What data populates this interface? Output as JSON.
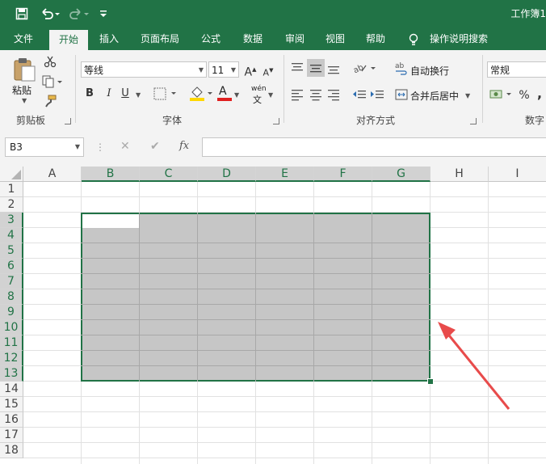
{
  "app": {
    "title": "工作簿1",
    "accent": "#217346"
  },
  "quick_access": {
    "save_icon": "save-icon",
    "undo_icon": "undo-icon",
    "redo_icon": "redo-icon",
    "customize_icon": "customize-icon"
  },
  "tabs": [
    {
      "label": "文件",
      "active": false
    },
    {
      "label": "开始",
      "active": true
    },
    {
      "label": "插入",
      "active": false
    },
    {
      "label": "页面布局",
      "active": false
    },
    {
      "label": "公式",
      "active": false
    },
    {
      "label": "数据",
      "active": false
    },
    {
      "label": "审阅",
      "active": false
    },
    {
      "label": "视图",
      "active": false
    },
    {
      "label": "帮助",
      "active": false
    },
    {
      "label": "操作说明搜索",
      "active": false
    }
  ],
  "ribbon": {
    "clipboard": {
      "label": "剪贴板",
      "paste_label": "粘贴"
    },
    "font": {
      "label": "字体",
      "font_name": "等线",
      "font_size": "11",
      "bold": "B",
      "italic": "I",
      "underline": "U",
      "grow_font": "A",
      "shrink_font": "A",
      "font_color": "A",
      "phonetic": "wén"
    },
    "alignment": {
      "label": "对齐方式",
      "wrap_text": "自动换行",
      "merge_center": "合并后居中"
    },
    "number": {
      "label": "数字",
      "format": "常规",
      "percent": "%",
      "comma": ","
    }
  },
  "formula_bar": {
    "name_box": "B3",
    "cancel": "✕",
    "enter": "✔",
    "fx": "fx",
    "value": ""
  },
  "grid": {
    "columns": [
      "A",
      "B",
      "C",
      "D",
      "E",
      "F",
      "G",
      "H",
      "I"
    ],
    "rows": [
      "1",
      "2",
      "3",
      "4",
      "5",
      "6",
      "7",
      "8",
      "9",
      "10",
      "11",
      "12",
      "13",
      "14",
      "15",
      "16",
      "17",
      "18"
    ],
    "selection": "B3:G13",
    "active_cell": "B3"
  },
  "annotation": {
    "arrow_color": "#e84b4b"
  }
}
